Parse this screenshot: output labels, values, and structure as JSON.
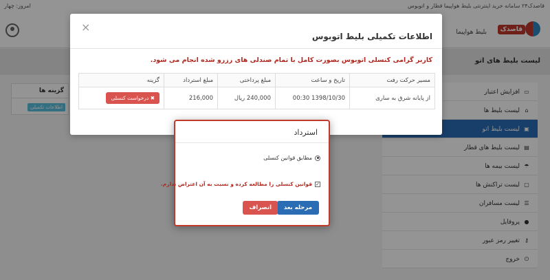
{
  "topbar": {
    "site_title": "قاصدک۲۴ سامانه خرید اینترنتی بلیط هواپیما قطار و اتوبوس",
    "date_label": "امروز: چهار"
  },
  "header": {
    "logo_text": "قاصدک",
    "nav_item": "بلیط هواپیما"
  },
  "background": {
    "page_title": "لیست بلیط های اتو",
    "options_title": "گزینه ها",
    "options_button": "اطلاعات تکمیلی"
  },
  "sidebar": {
    "items": [
      {
        "label": "افزایش اعتبار",
        "icon": "credit-card-icon"
      },
      {
        "label": "لیست بلیط ها",
        "icon": "home-icon"
      },
      {
        "label": "لیست بلیط اتو",
        "icon": "bus-icon",
        "active": true
      },
      {
        "label": "لیست بلیط های قطار",
        "icon": "train-icon"
      },
      {
        "label": "لیست بیمه ها",
        "icon": "umbrella-icon"
      },
      {
        "label": "لیست تراکنش ها",
        "icon": "transactions-icon"
      },
      {
        "label": "لیست مسافران",
        "icon": "list-icon"
      },
      {
        "label": "پروفایل",
        "icon": "user-icon"
      },
      {
        "label": "تغییر رمز عبور",
        "icon": "key-icon"
      },
      {
        "label": "خروج",
        "icon": "power-icon"
      }
    ]
  },
  "details_modal": {
    "title": "اطلاعات تکمیلی بلیط اتوبوس",
    "warning": "کاربر گرامی کنسلی اتوبوس بصورت کامل با تمام صندلی های رزرو شده انجام می شود.",
    "columns": {
      "route": "مسیر حرکت رفت",
      "datetime": "تاریخ و ساعت",
      "paid": "مبلغ پرداختی",
      "refund": "مبلغ استرداد",
      "option": "گزینه"
    },
    "row": {
      "route": "از پایانه شرق به ساری",
      "datetime": "1398/10/30  00:30",
      "paid": "240,000 ریال",
      "refund": "216,000",
      "cancel_label": "✖ درخواست کنسلی"
    }
  },
  "refund_modal": {
    "title": "استرداد",
    "radio_label": "مطابق قوانین کنسلی",
    "checkbox_label": "قوانین کنسلی را مطالعه کرده و نسبت به آن اعتراض ندارم.",
    "next_label": "مرحله بعد",
    "dismiss_label": "انصراف"
  }
}
